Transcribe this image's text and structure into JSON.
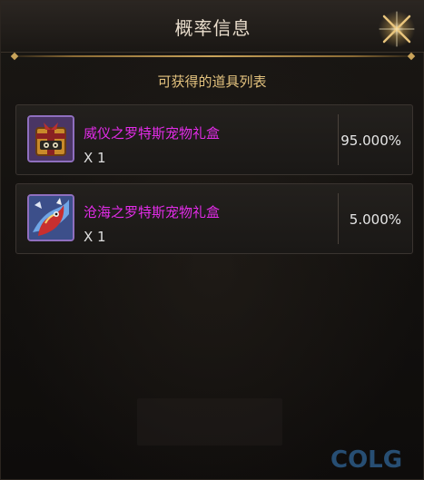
{
  "dialog": {
    "title": "概率信息",
    "close_icon": "close-x-icon"
  },
  "list": {
    "heading": "可获得的道具列表",
    "items": [
      {
        "name": "威仪之罗特斯宠物礼盒",
        "quantity": "X 1",
        "probability": "95.000%",
        "icon": "gift-box-icon"
      },
      {
        "name": "沧海之罗特斯宠物礼盒",
        "quantity": "X 1",
        "probability": "5.000%",
        "icon": "pet-creature-icon"
      }
    ]
  },
  "colors": {
    "item_name": "#e22ce8",
    "heading": "#e3c27e",
    "title": "#e8dccb",
    "accent_gold": "#c9a35a"
  },
  "watermark": {
    "text": "COLG"
  }
}
